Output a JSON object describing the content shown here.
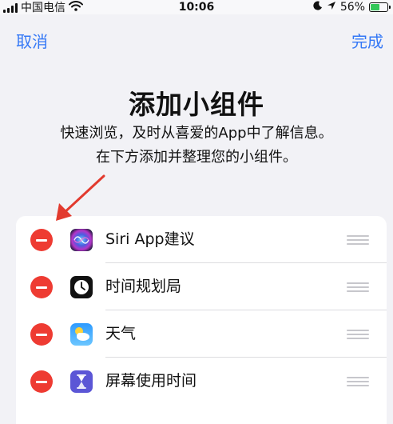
{
  "status": {
    "carrier": "中国电信",
    "time": "10:06",
    "battery": "56%",
    "battery_level": 0.56,
    "icons": [
      "signal-icon",
      "wifi-icon",
      "moon-icon",
      "location-icon",
      "battery-icon"
    ]
  },
  "nav": {
    "cancel": "取消",
    "done": "完成"
  },
  "header": {
    "title": "添加小组件",
    "subtitle_line1": "快速浏览，及时从喜爱的App中了解信息。",
    "subtitle_line2": "在下方添加并整理您的小组件。"
  },
  "widgets": [
    {
      "label": "Siri App建议",
      "icon": "siri-icon"
    },
    {
      "label": "时间规划局",
      "icon": "clock-icon"
    },
    {
      "label": "天气",
      "icon": "weather-icon"
    },
    {
      "label": "屏幕使用时间",
      "icon": "hourglass-icon"
    }
  ],
  "colors": {
    "accent": "#3478f6",
    "remove": "#ee3b32",
    "arrow": "#e23a2e",
    "battery": "#34c759"
  }
}
